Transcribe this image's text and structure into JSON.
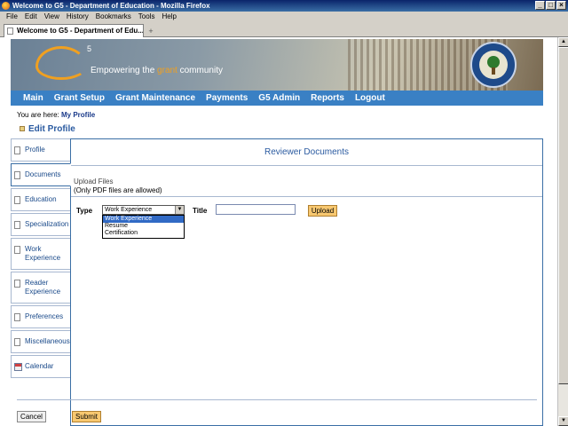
{
  "window": {
    "title": "Welcome to G5 - Department of Education - Mozilla Firefox"
  },
  "menubar": [
    "File",
    "Edit",
    "View",
    "History",
    "Bookmarks",
    "Tools",
    "Help"
  ],
  "browser_tab": {
    "label": "Welcome to G5 - Department of Edu..."
  },
  "banner": {
    "logo_sup": "5",
    "tagline_pre": "Empowering the ",
    "tagline_hl": "grant",
    "tagline_post": " community"
  },
  "nav": [
    "Main",
    "Grant Setup",
    "Grant Maintenance",
    "Payments",
    "G5 Admin",
    "Reports",
    "Logout"
  ],
  "breadcrumb": {
    "prefix": "You are here:",
    "link": "My Profile"
  },
  "page_title": "Edit Profile",
  "side_tabs": [
    {
      "label": "Profile"
    },
    {
      "label": "Documents"
    },
    {
      "label": "Education"
    },
    {
      "label": "Specialization"
    },
    {
      "label": "Work Experience"
    },
    {
      "label": "Reader Experience"
    },
    {
      "label": "Preferences"
    },
    {
      "label": "Miscellaneous"
    },
    {
      "label": "Calendar"
    }
  ],
  "panel": {
    "heading": "Reviewer Documents",
    "upload_title": "Upload Files",
    "upload_note": "(Only PDF files are allowed)",
    "type_label": "Type",
    "type_selected": "Work Experience",
    "type_options": [
      "Work Experience",
      "Resume",
      "Certification"
    ],
    "title_label": "Title",
    "title_value": "",
    "upload_label": "Upload"
  },
  "footer": {
    "cancel_label": "Cancel",
    "submit_label": "Submit"
  },
  "colors": {
    "nav_bg": "#3a80c4",
    "accent_orange": "#f0a020",
    "heading_blue": "#2a5aa0",
    "select_highlight": "#316ac5"
  }
}
